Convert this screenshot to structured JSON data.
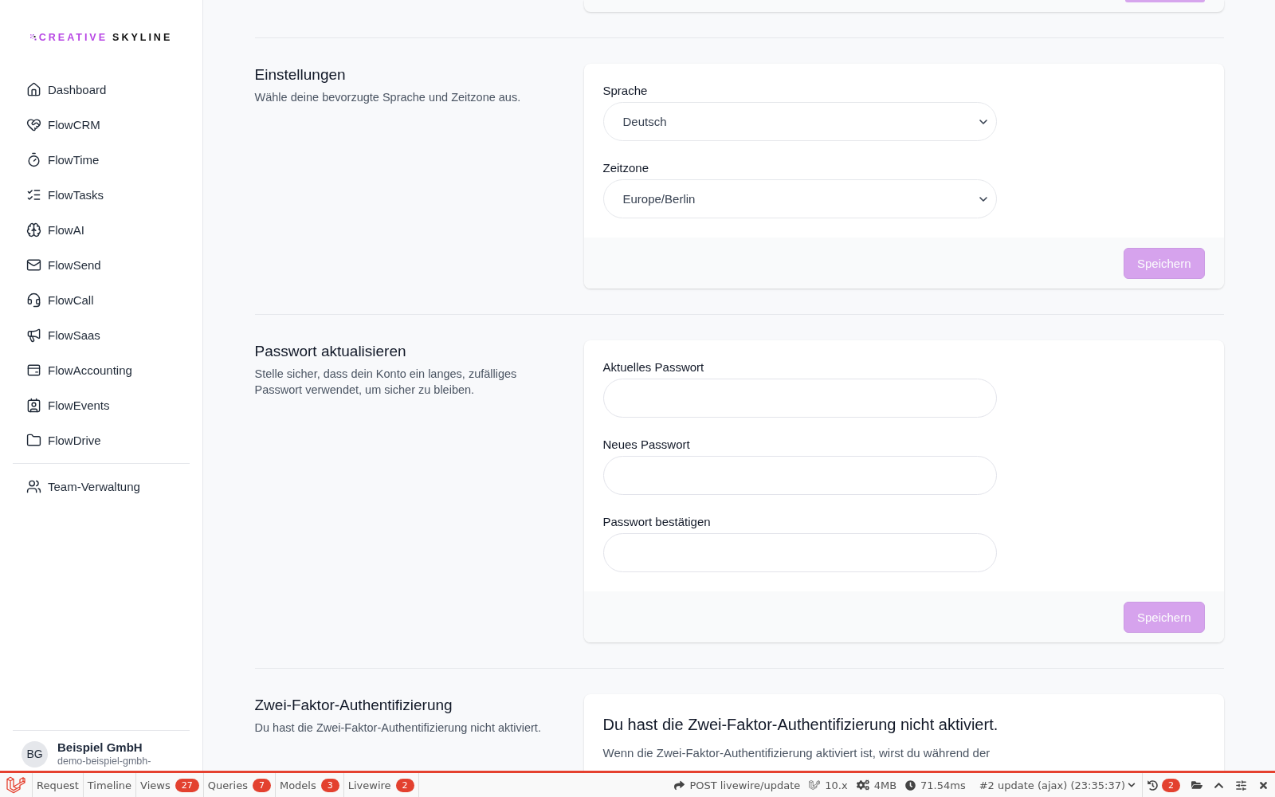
{
  "sidebar": {
    "logo": {
      "brand": "CREATIVE",
      "name": "SKYLINE"
    },
    "nav_items": [
      {
        "label": "Dashboard",
        "selected": false
      },
      {
        "label": "FlowCRM",
        "selected": false
      },
      {
        "label": "FlowTime",
        "selected": false
      },
      {
        "label": "FlowTasks",
        "selected": false
      },
      {
        "label": "FlowAI",
        "selected": false
      },
      {
        "label": "FlowSend",
        "selected": false
      },
      {
        "label": "FlowCall",
        "selected": false
      },
      {
        "label": "FlowSaas",
        "selected": false
      },
      {
        "label": "FlowAccounting",
        "selected": false
      },
      {
        "label": "FlowEvents",
        "selected": false
      },
      {
        "label": "FlowDrive",
        "selected": false
      }
    ],
    "secondary_items": [
      {
        "label": "Team-Verwaltung",
        "selected": false
      }
    ],
    "account": {
      "initials": "BG",
      "name": "Beispiel GmbH",
      "subtitle": "demo-beispiel-gmbh-"
    }
  },
  "main": {
    "previous_section": {
      "submit": {
        "disabled": true
      }
    },
    "sections": [
      {
        "kind": "form",
        "title": "Einstellungen",
        "description": "Wähle deine bevorzugte Sprache und Zeitzone aus.",
        "fields": [
          {
            "kind": "select",
            "label": "Sprache",
            "value": "Deutsch"
          },
          {
            "kind": "select",
            "label": "Zeitzone",
            "value": "Europe/Berlin"
          }
        ],
        "submit": {
          "label": "Speichern",
          "disabled": true
        }
      },
      {
        "kind": "form",
        "title": "Passwort aktualisieren",
        "description": "Stelle sicher, dass dein Konto ein langes, zufälliges Passwort verwendet, um sicher zu bleiben.",
        "fields": [
          {
            "kind": "password",
            "label": "Aktuelles Passwort"
          },
          {
            "kind": "password",
            "label": "Neues Passwort"
          },
          {
            "kind": "password",
            "label": "Passwort bestätigen"
          }
        ],
        "submit": {
          "label": "Speichern",
          "disabled": true
        }
      },
      {
        "kind": "notice",
        "title": "Zwei-Faktor-Authentifizierung",
        "description": "Du hast die Zwei-Faktor-Authentifizierung nicht aktiviert.",
        "heading": "Du hast die Zwei-Faktor-Authentifizierung nicht aktiviert.",
        "text": "Wenn die Zwei-Faktor-Authentifizierung aktiviert ist, wirst du während der"
      }
    ]
  },
  "debug_bar": {
    "tabs": [
      {
        "label": "Request",
        "selected": false
      },
      {
        "label": "Timeline",
        "selected": false
      },
      {
        "label": "Views",
        "badge": "27",
        "selected": false
      },
      {
        "label": "Queries",
        "badge": "7",
        "selected": false
      },
      {
        "label": "Models",
        "badge": "3",
        "selected": false
      },
      {
        "label": "Livewire",
        "badge": "2",
        "selected": false
      }
    ],
    "request": "POST livewire/update",
    "version": "10.x",
    "memory": "4MB",
    "duration": "71.54ms",
    "request_selector": "#2 update (ajax) (23:35:37)",
    "history_badge": "2"
  }
}
